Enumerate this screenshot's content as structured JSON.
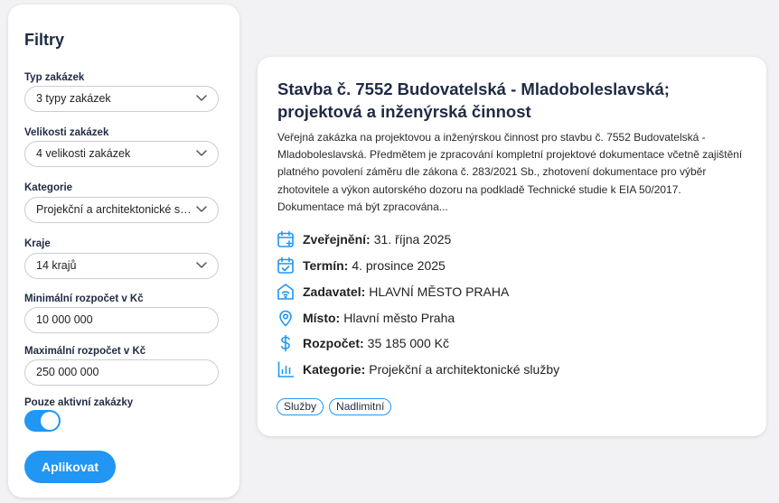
{
  "filters": {
    "title": "Filtry",
    "type_label": "Typ zakázek",
    "type_value": "3 typy zakázek",
    "size_label": "Velikosti zakázek",
    "size_value": "4 velikosti zakázek",
    "category_label": "Kategorie",
    "category_value": "Projekční a architektonické služby",
    "region_label": "Kraje",
    "region_value": "14 krajů",
    "min_budget_label": "Minimální rozpočet v Kč",
    "min_budget_value": "10 000 000",
    "max_budget_label": "Maximální rozpočet v Kč",
    "max_budget_value": "250 000 000",
    "active_label": "Pouze aktivní zakázky",
    "active_on": true,
    "apply_label": "Aplikovat"
  },
  "card": {
    "title": "Stavba č. 7552 Budovatelská - Mladoboleslavská; projektová a inženýrská činnost",
    "description": "Veřejná zakázka na projektovou a inženýrskou činnost pro stavbu č. 7552 Budovatelská - Mladoboleslavská. Předmětem je zpracování kompletní projektové dokumentace včetně zajištění platného povolení záměru dle zákona č. 283/2021 Sb., zhotovení dokumentace pro výběr zhotovitele a výkon autorského dozoru na podkladě Technické studie k EIA 50/2017. Dokumentace má být zpracována...",
    "published_label": "Zveřejnění:",
    "published_value": "31. října 2025",
    "deadline_label": "Termín:",
    "deadline_value": "4. prosince 2025",
    "contracting_label": "Zadavatel:",
    "contracting_value": "HLAVNÍ MĚSTO PRAHA",
    "place_label": "Místo:",
    "place_value": "Hlavní město Praha",
    "budget_label": "Rozpočet:",
    "budget_value": "35 185 000 Kč",
    "category_label": "Kategorie:",
    "category_value": "Projekční a architektonické služby",
    "tags": [
      "Služby",
      "Nadlimitní"
    ]
  },
  "colors": {
    "accent": "#2196f3",
    "heading": "#1f2a44",
    "background": "#f2f2f4"
  },
  "icons": {
    "published": "calendar-plus-icon",
    "deadline": "calendar-check-icon",
    "contracting": "building-icon",
    "place": "map-pin-icon",
    "budget": "dollar-icon",
    "category": "bar-chart-icon"
  }
}
